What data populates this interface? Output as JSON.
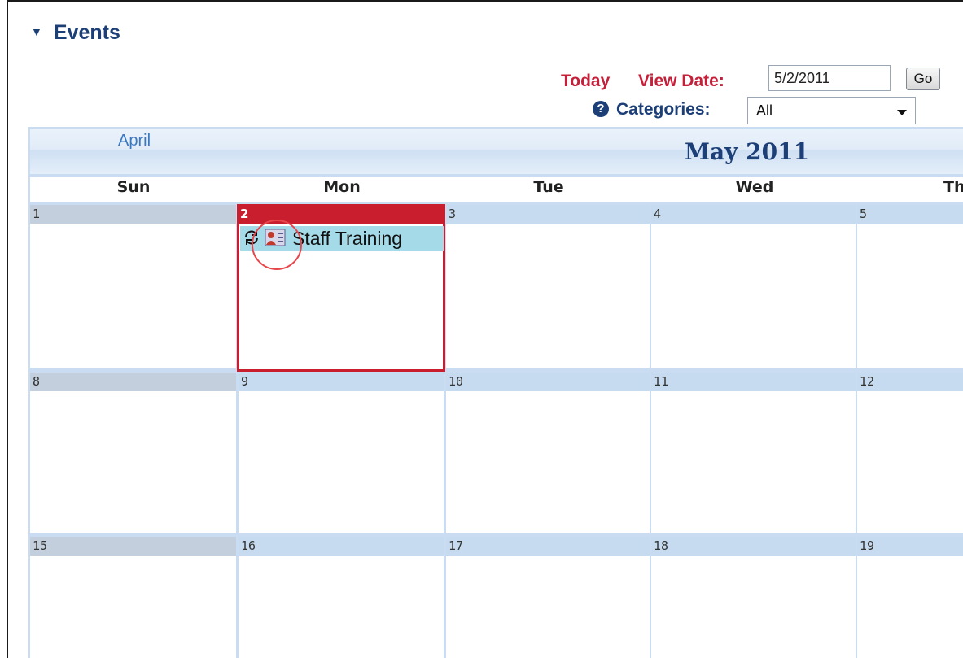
{
  "panel": {
    "title": "Events"
  },
  "toolbar": {
    "today_label": "Today",
    "view_date_label": "View Date:",
    "view_date_value": "5/2/2011",
    "go_label": "Go",
    "help_icon": "question-circle-icon",
    "categories_label": "Categories:",
    "categories_value": "All"
  },
  "calendar": {
    "prev_month_label": "April",
    "month_title": "May 2011",
    "weekdays": [
      "Sun",
      "Mon",
      "Tue",
      "Wed",
      "Th"
    ],
    "weeks": [
      [
        "1",
        "2",
        "3",
        "4",
        "5"
      ],
      [
        "8",
        "9",
        "10",
        "11",
        "12"
      ],
      [
        "15",
        "16",
        "17",
        "18",
        "19"
      ]
    ],
    "today": "2",
    "events": [
      {
        "day": "2",
        "title": "Staff Training",
        "icons": [
          "recurring-icon",
          "person-card-icon"
        ]
      }
    ]
  },
  "colors": {
    "accent_red": "#c81e2e",
    "heading_blue": "#1c3f77",
    "day_bar_blue": "#c6dbef",
    "event_bg": "#a5dbe9"
  }
}
